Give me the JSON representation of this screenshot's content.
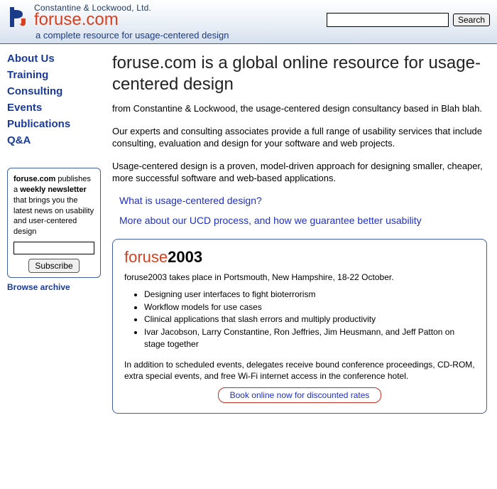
{
  "header": {
    "company": "Constantine & Lockwood, Ltd.",
    "site": "foruse.com",
    "tagline": "a complete resource for usage-centered design",
    "search_button": "Search"
  },
  "nav": {
    "items": [
      "About Us",
      "Training",
      "Consulting",
      "Events",
      "Publications",
      "Q&A"
    ]
  },
  "newsletter": {
    "site_bold": "foruse.com",
    "pub_text": " publishes a ",
    "weekly_bold": "weekly newsletter",
    "rest_text": " that brings you the latest news on usability and user-centered design",
    "subscribe": "Subscribe",
    "archive": "Browse archive"
  },
  "main": {
    "heading": "foruse.com is a global online resource for usage-centered design",
    "p1": "from Constantine & Lockwood, the usage-centered design consultancy based in Blah blah.",
    "p2": "Our experts and consulting associates provide a full range of usability services  that include consulting, evaluation and design for your software and web projects.",
    "p3": "Usage-centered design is a proven, model-driven approach for designing smaller, cheaper, more successful software and web-based applications.",
    "link1": "What is usage-centered design?",
    "link2": "More about our UCD process, and how we guarantee better usability"
  },
  "event": {
    "brand": "foruse",
    "year": "2003",
    "intro": "foruse2003 takes place in Portsmouth, New Hampshire, 18-22 October.",
    "bullets": [
      "Designing user interfaces to fight bioterrorism",
      "Workflow models for use cases",
      "Clinical applications that slash errors and multiply productivity",
      "Ivar Jacobson, Larry Constantine, Ron Jeffries, Jim Heusmann, and Jeff Patton on stage together"
    ],
    "extras": "In addition to scheduled events, delegates receive bound conference proceedings, CD-ROM, extra special events, and free Wi-Fi internet access in the conference hotel.",
    "cta": "Book online now for discounted rates"
  }
}
